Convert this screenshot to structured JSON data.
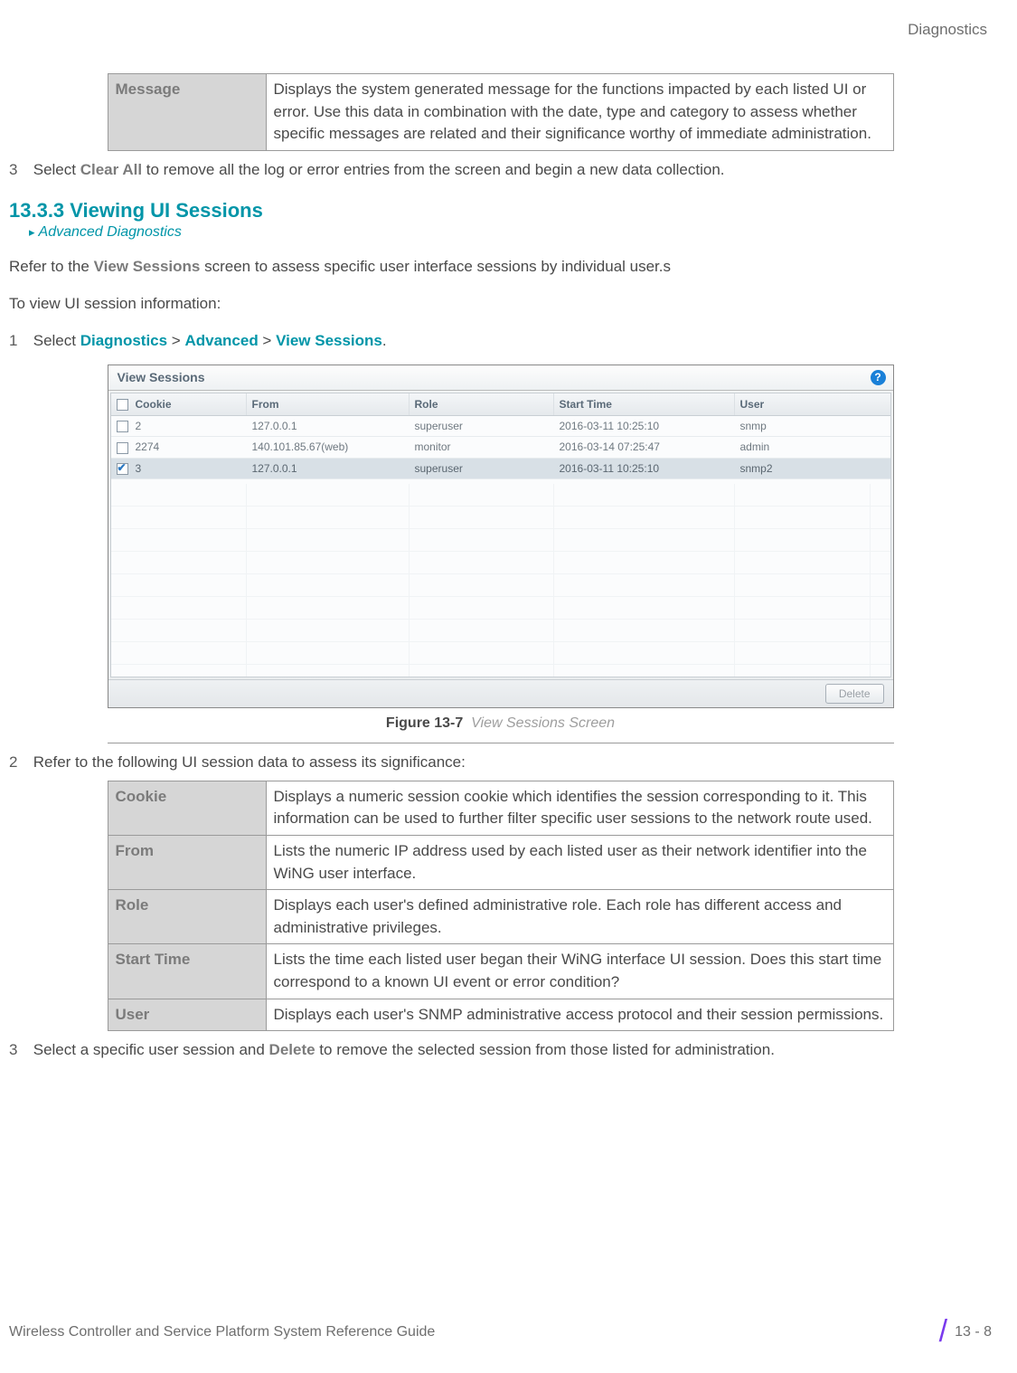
{
  "header": {
    "section": "Diagnostics"
  },
  "table1": {
    "rows": [
      {
        "label": "Message",
        "text": "Displays the system generated message for the functions impacted by each listed UI or error. Use this data in combination with the date, type and category to assess whether specific messages are related and their significance worthy of immediate administration."
      }
    ]
  },
  "step_top": {
    "num": "3",
    "pre": "Select ",
    "bold": "Clear All",
    "post": " to remove all the log or error entries from the screen and begin a new data collection."
  },
  "sec": {
    "title": "13.3.3 Viewing UI Sessions",
    "bc_arrow": "▸",
    "bc": "Advanced Diagnostics"
  },
  "para1": {
    "pre": "Refer to the ",
    "bold": "View Sessions",
    "post": " screen to assess specific user interface sessions by individual user.s"
  },
  "para2": "To view UI session information:",
  "navstep": {
    "num": "1",
    "pre": "Select ",
    "p1": "Diagnostics",
    "s1": " > ",
    "p2": "Advanced",
    "s2": " > ",
    "p3": "View Sessions",
    "end": "."
  },
  "scr": {
    "title": "View Sessions",
    "help": "?",
    "cols": [
      "Cookie",
      "From",
      "Role",
      "Start Time",
      "User"
    ],
    "rows": [
      {
        "sel": false,
        "cookie": "2",
        "from": "127.0.0.1",
        "role": "superuser",
        "start": "2016-03-11 10:25:10",
        "user": "snmp"
      },
      {
        "sel": false,
        "cookie": "2274",
        "from": "140.101.85.67(web)",
        "role": "monitor",
        "start": "2016-03-14 07:25:47",
        "user": "admin"
      },
      {
        "sel": true,
        "cookie": "3",
        "from": "127.0.0.1",
        "role": "superuser",
        "start": "2016-03-11 10:25:10",
        "user": "snmp2"
      }
    ],
    "delete_label": "Delete"
  },
  "figcap": {
    "b": "Figure 13-7",
    "i": "View Sessions Screen"
  },
  "step2": {
    "num": "2",
    "text": "Refer to the following UI session data to assess its significance:"
  },
  "table2": {
    "rows": [
      {
        "label": "Cookie",
        "text": "Displays a numeric session cookie which identifies the session corresponding to it. This information can be used to further filter specific user sessions to the network route used."
      },
      {
        "label": "From",
        "text": "Lists the numeric IP address used by each listed user as their network identifier into the WiNG user interface."
      },
      {
        "label": "Role",
        "text": "Displays each user's defined administrative role. Each role has different access and administrative privileges."
      },
      {
        "label": "Start Time",
        "text": "Lists the time each listed user began their WiNG interface UI session. Does this start time correspond to a known UI event or error condition?"
      },
      {
        "label": "User",
        "text": "Displays each user's SNMP administrative access protocol and their session permissions."
      }
    ]
  },
  "step3": {
    "num": "3",
    "pre": "Select a specific user session and ",
    "bold": "Delete",
    "post": " to remove the selected session from those listed for administration."
  },
  "footer": {
    "left": "Wireless Controller and Service Platform System Reference Guide",
    "right": "13 - 8"
  }
}
